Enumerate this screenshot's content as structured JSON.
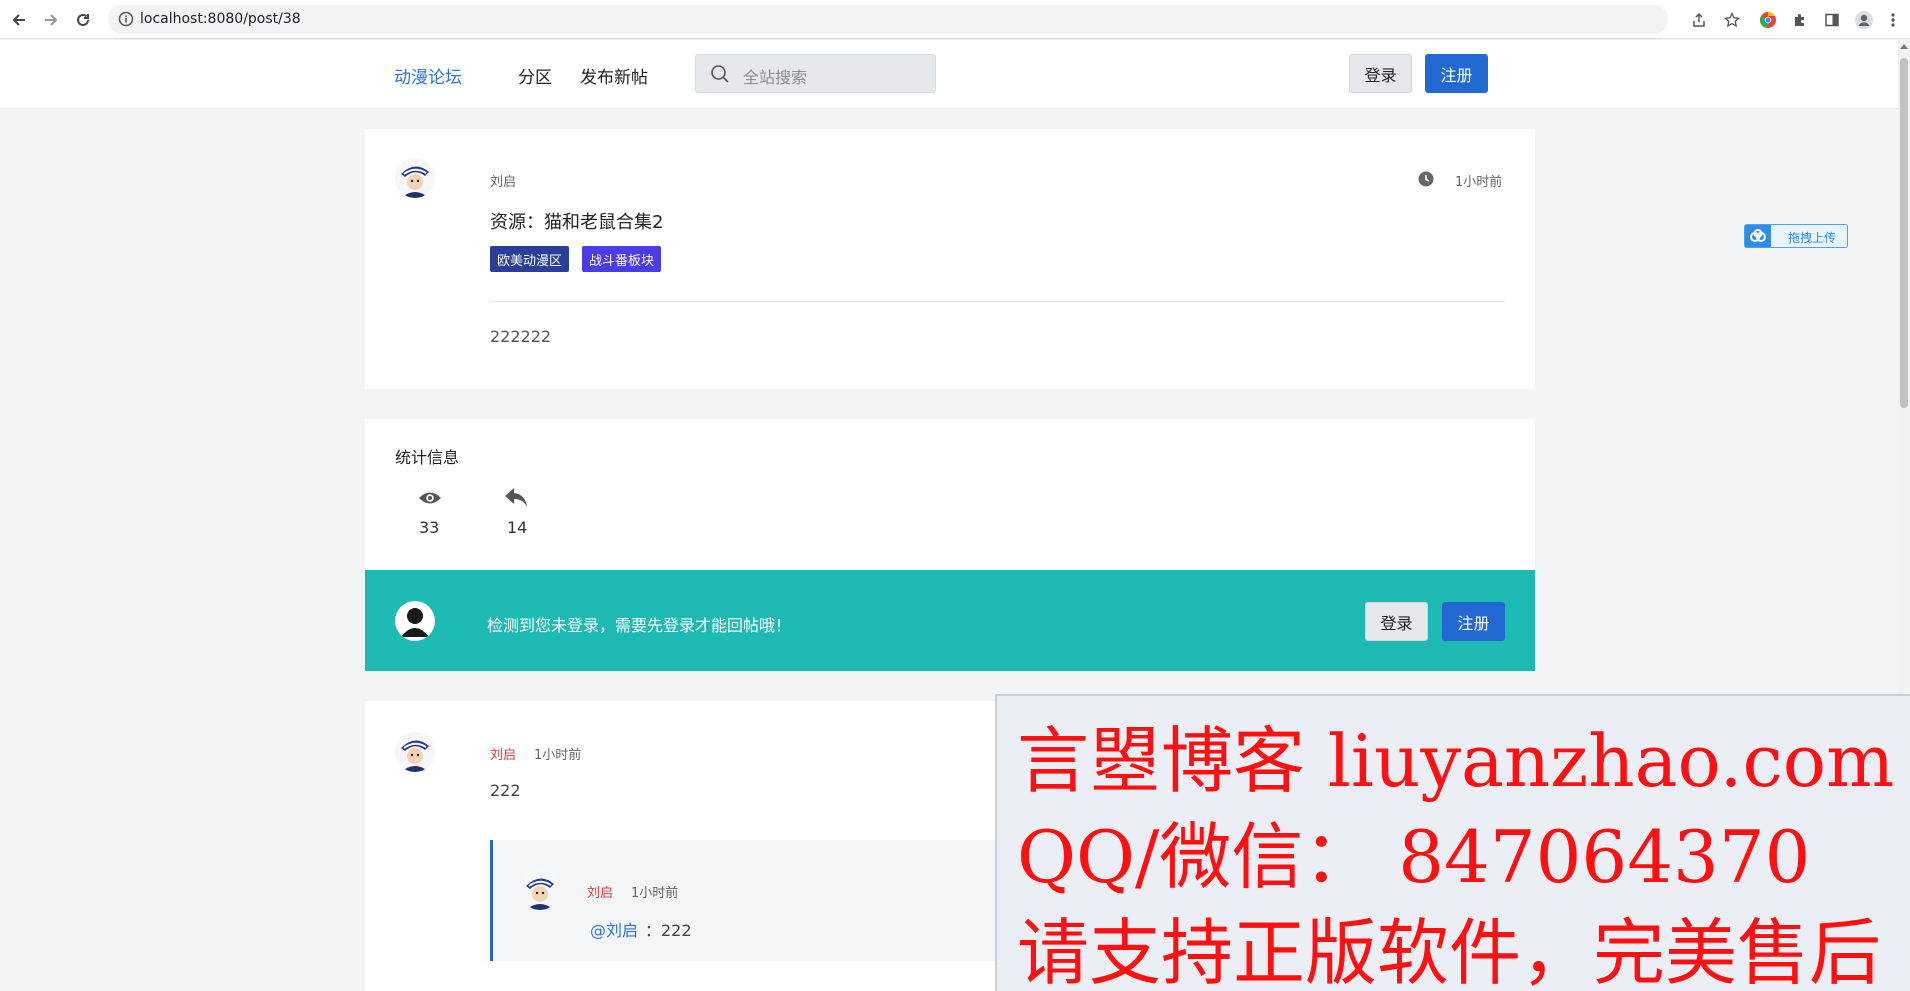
{
  "browser": {
    "url": "localhost:8080/post/38",
    "icons": [
      "back-icon",
      "forward-icon",
      "reload-icon",
      "info-icon",
      "share-icon",
      "star-icon",
      "chrome-extension-icon",
      "puzzle-icon",
      "sidepanel-icon",
      "profile-icon",
      "kebab-menu-icon"
    ]
  },
  "header": {
    "brand": "动漫论坛",
    "nav": [
      "分区",
      "发布新帖"
    ],
    "search_placeholder": "全站搜索",
    "login": "登录",
    "register": "注册"
  },
  "post": {
    "author": "刘启",
    "time": "1小时前",
    "title": "资源：猫和老鼠合集2",
    "tags": [
      {
        "label": "欧美动漫区",
        "color": "#2a3e9a"
      },
      {
        "label": "战斗番板块",
        "color": "#4a3ce6"
      }
    ],
    "content": "222222"
  },
  "upload_badge": "拖拽上传",
  "stats": {
    "heading": "统计信息",
    "views": "33",
    "replies": "14"
  },
  "login_notice": {
    "text": "检测到您未登录，需要先登录才能回帖哦！",
    "login": "登录",
    "register": "注册"
  },
  "comments": [
    {
      "author": "刘启",
      "time": "1小时前",
      "content": "222",
      "replies": [
        {
          "author": "刘启",
          "time": "1小时前",
          "mention": "@刘启",
          "content": "：222"
        }
      ]
    }
  ],
  "watermark": {
    "line1": "言曌博客 liuyanzhao.com",
    "line2": "QQ/微信： 847064370",
    "line3": "请支持正版软件，完美售后"
  },
  "colors": {
    "accent_blue": "#2268d1",
    "teal": "#1dbab4",
    "author_red": "#e03b3b",
    "watermark_red": "#ff1010"
  }
}
